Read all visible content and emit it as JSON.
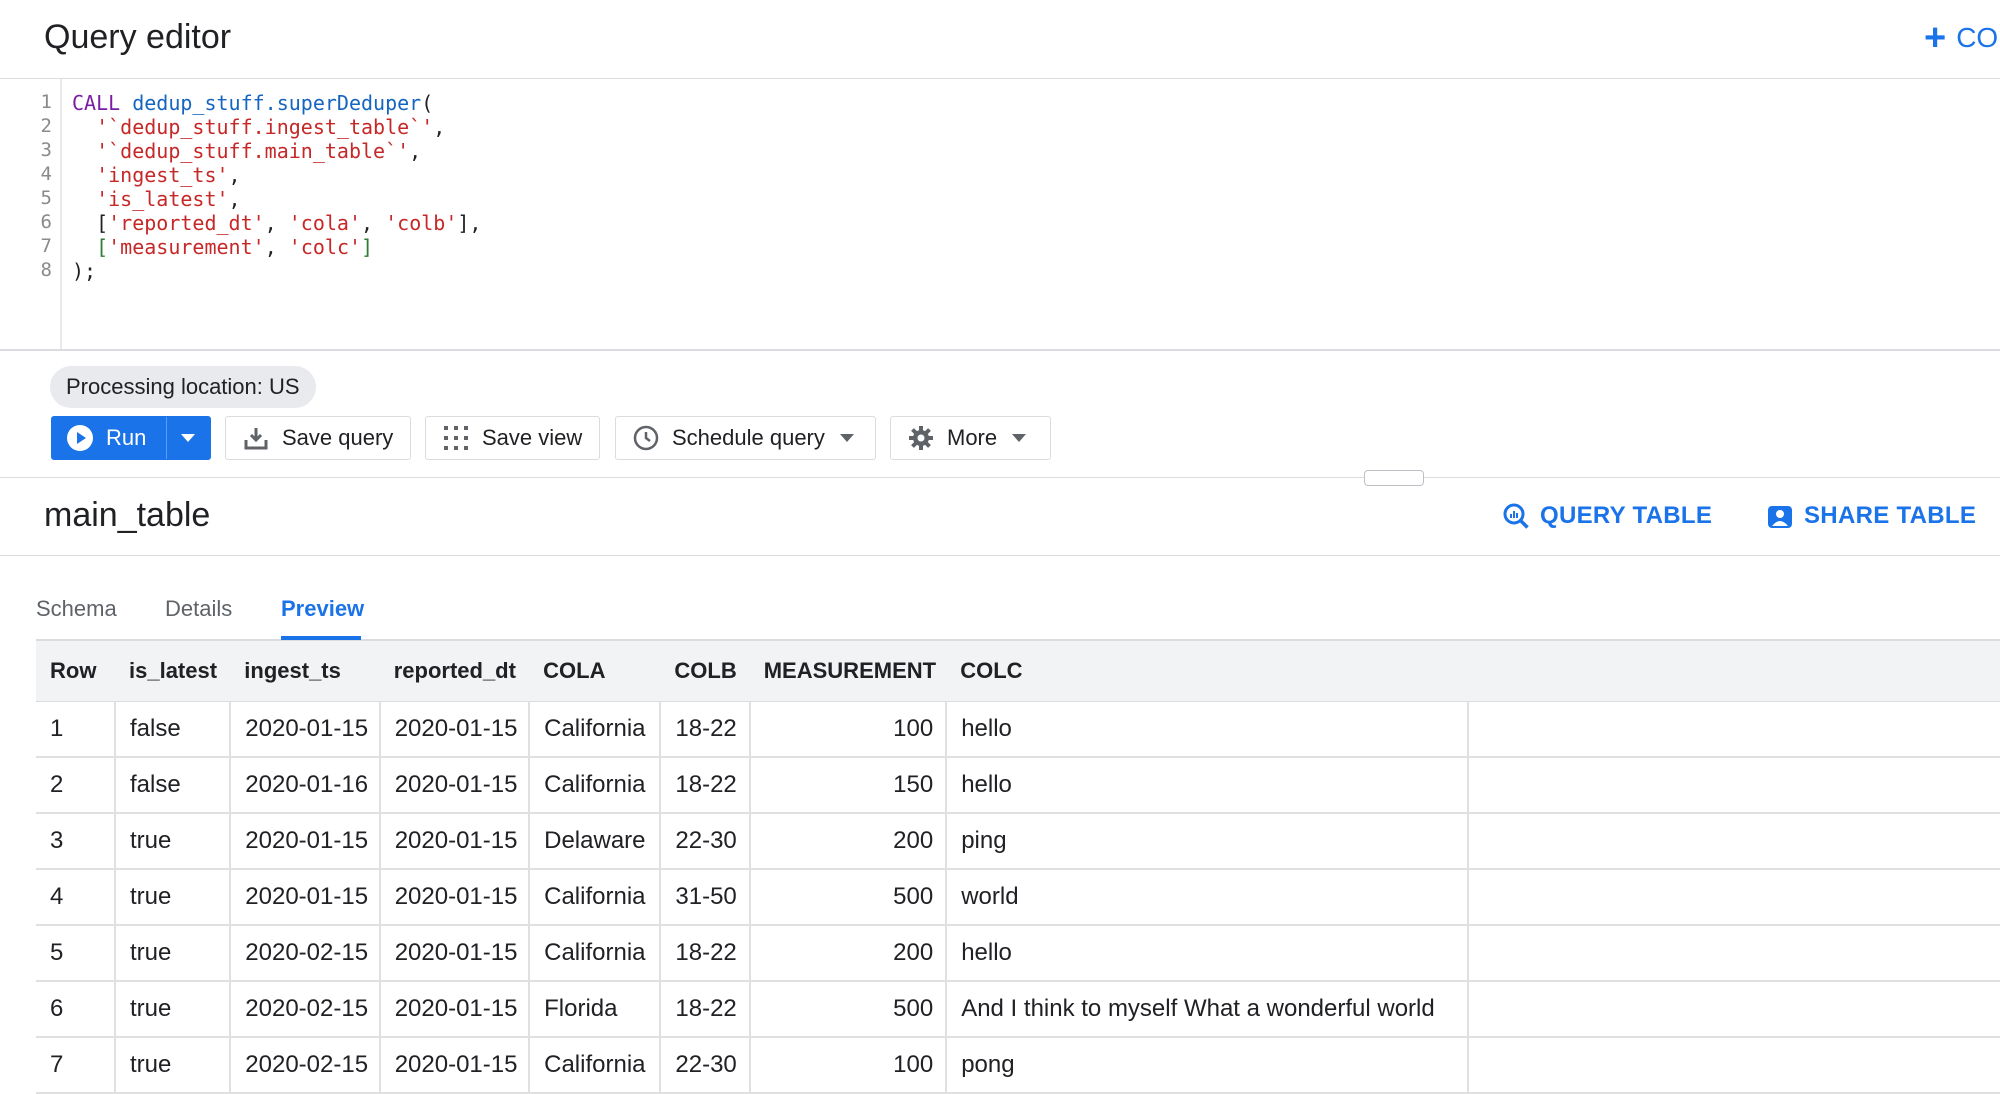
{
  "header": {
    "title": "Query editor",
    "compose_label": "CO"
  },
  "editor": {
    "line_numbers": [
      "1",
      "2",
      "3",
      "4",
      "5",
      "6",
      "7",
      "8"
    ]
  },
  "processing_location": "Processing location: US",
  "toolbar": {
    "run_label": "Run",
    "save_query_label": "Save query",
    "save_view_label": "Save view",
    "schedule_query_label": "Schedule query",
    "more_label": "More"
  },
  "table_panel": {
    "name": "main_table",
    "query_table_label": "QUERY TABLE",
    "share_table_label": "SHARE TABLE",
    "tabs": [
      "Schema",
      "Details",
      "Preview"
    ],
    "active_tab": "Preview"
  },
  "results": {
    "columns": [
      "Row",
      "is_latest",
      "ingest_ts",
      "reported_dt",
      "COLA",
      "COLB",
      "MEASUREMENT",
      "COLC"
    ],
    "rows": [
      [
        "1",
        "false",
        "2020-01-15",
        "2020-01-15",
        "California",
        "18-22",
        "100",
        "hello"
      ],
      [
        "2",
        "false",
        "2020-01-16",
        "2020-01-15",
        "California",
        "18-22",
        "150",
        "hello"
      ],
      [
        "3",
        "true",
        "2020-01-15",
        "2020-01-15",
        "Delaware",
        "22-30",
        "200",
        "ping"
      ],
      [
        "4",
        "true",
        "2020-01-15",
        "2020-01-15",
        "California",
        "31-50",
        "500",
        "world"
      ],
      [
        "5",
        "true",
        "2020-02-15",
        "2020-01-15",
        "California",
        "18-22",
        "200",
        "hello"
      ],
      [
        "6",
        "true",
        "2020-02-15",
        "2020-01-15",
        "Florida",
        "18-22",
        "500",
        "And I think to myself What a wonderful world"
      ],
      [
        "7",
        "true",
        "2020-02-15",
        "2020-01-15",
        "California",
        "22-30",
        "100",
        "pong"
      ]
    ]
  },
  "colors": {
    "accent": "#1a73e8",
    "keyword": "#7b1fa2",
    "function": "#1565c0",
    "string": "#c62828",
    "bracket": "#2e7d32"
  },
  "icons": [
    "plus-icon",
    "play-icon",
    "chevron-down-icon",
    "download-icon",
    "grid-icon",
    "clock-icon",
    "gear-icon",
    "query-search-icon",
    "share-icon"
  ]
}
